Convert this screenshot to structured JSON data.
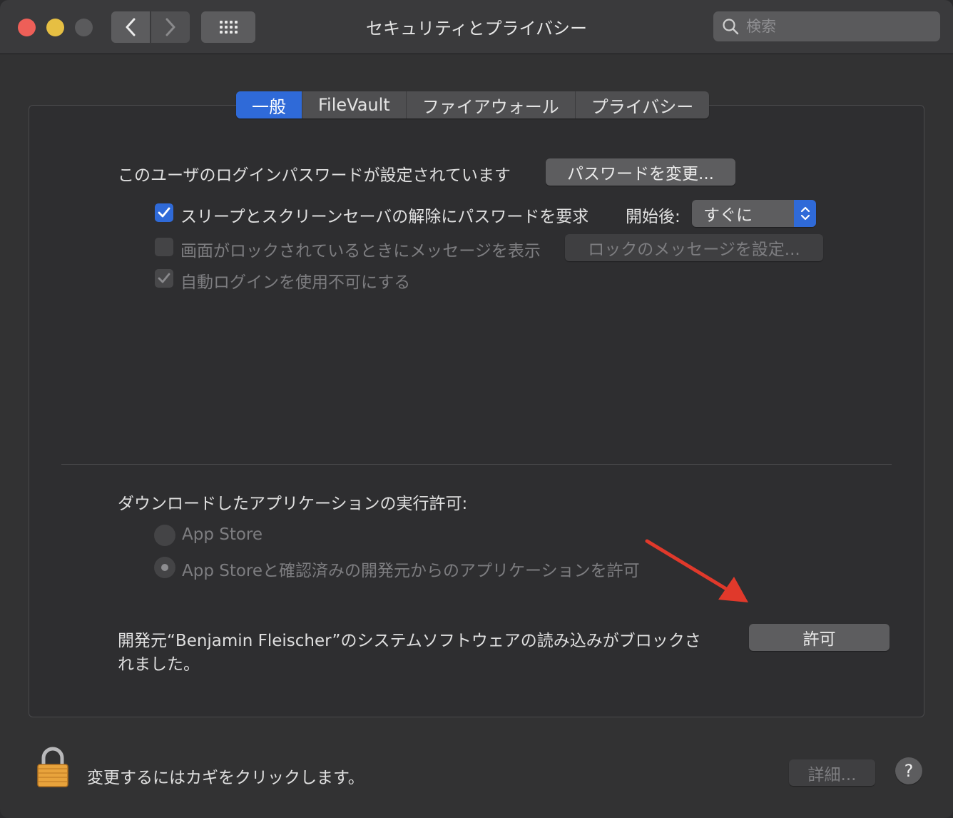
{
  "window": {
    "title": "セキュリティとプライバシー",
    "search_placeholder": "検索"
  },
  "tabs": [
    {
      "label": "一般",
      "active": true
    },
    {
      "label": "FileVault",
      "active": false
    },
    {
      "label": "ファイアウォール",
      "active": false
    },
    {
      "label": "プライバシー",
      "active": false
    }
  ],
  "general": {
    "password_status": "このユーザのログインパスワードが設定されています",
    "change_password_button": "パスワードを変更...",
    "require_password_label": "スリープとスクリーンセーバの解除にパスワードを要求",
    "require_password_checked": true,
    "after_label": "開始後:",
    "after_value": "すぐに",
    "lock_message_label": "画面がロックされているときにメッセージを表示",
    "lock_message_checked": false,
    "lock_message_button": "ロックのメッセージを設定...",
    "disable_autologin_label": "自動ログインを使用不可にする",
    "disable_autologin_checked": true
  },
  "downloads": {
    "heading": "ダウンロードしたアプリケーションの実行許可:",
    "option_app_store": "App Store",
    "option_app_store_dev": "App Storeと確認済みの開発元からのアプリケーションを許可",
    "selected": "option_app_store_dev"
  },
  "blocked": {
    "message_line1": "開発元“Benjamin Fleischer”のシステムソフトウェアの読み込みがブロックさ",
    "message_line2": "れました。",
    "allow_button": "許可"
  },
  "footer": {
    "lock_text": "変更するにはカギをクリックします。",
    "details_button": "詳細...",
    "help_button": "?"
  },
  "colors": {
    "accent": "#2f6ad8",
    "annotation_arrow": "#e0392b",
    "close": "#ee5f58",
    "minimize": "#e6bf43"
  }
}
